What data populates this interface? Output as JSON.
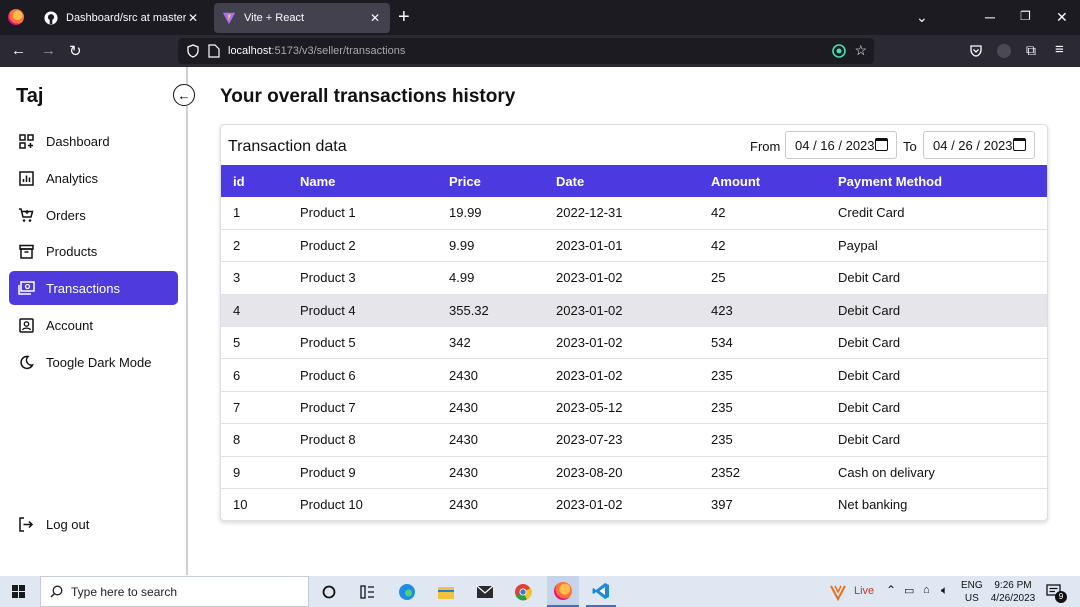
{
  "browser": {
    "tabs": [
      {
        "title": "Dashboard/src at master · Hayat"
      },
      {
        "title": "Vite + React"
      }
    ],
    "url_host": "localhost",
    "url_path": ":5173/v3/seller/transactions"
  },
  "sidebar": {
    "brand": "Taj",
    "items": [
      {
        "label": "Dashboard",
        "icon": "dashboard-icon"
      },
      {
        "label": "Analytics",
        "icon": "analytics-icon"
      },
      {
        "label": "Orders",
        "icon": "cart-icon"
      },
      {
        "label": "Products",
        "icon": "archive-icon"
      },
      {
        "label": "Transactions",
        "icon": "payments-icon",
        "active": true
      },
      {
        "label": "Account",
        "icon": "account-icon"
      },
      {
        "label": "Toogle Dark Mode",
        "icon": "moon-icon"
      }
    ],
    "logout": "Log out"
  },
  "main": {
    "title": "Your overall transactions history",
    "card_title": "Transaction data",
    "from_label": "From",
    "from_value": "04 / 16 / 2023",
    "to_label": "To",
    "to_value": "04 / 26 / 2023"
  },
  "table": {
    "columns": [
      "id",
      "Name",
      "Price",
      "Date",
      "Amount",
      "Payment Method"
    ],
    "rows": [
      [
        "1",
        "Product 1",
        "19.99",
        "2022-12-31",
        "42",
        "Credit Card"
      ],
      [
        "2",
        "Product 2",
        "9.99",
        "2023-01-01",
        "42",
        "Paypal"
      ],
      [
        "3",
        "Product 3",
        "4.99",
        "2023-01-02",
        "25",
        "Debit Card"
      ],
      [
        "4",
        "Product 4",
        "355.32",
        "2023-01-02",
        "423",
        "Debit Card"
      ],
      [
        "5",
        "Product 5",
        "342",
        "2023-01-02",
        "534",
        "Debit Card"
      ],
      [
        "6",
        "Product 6",
        "2430",
        "2023-01-02",
        "235",
        "Debit Card"
      ],
      [
        "7",
        "Product 7",
        "2430",
        "2023-05-12",
        "235",
        "Debit Card"
      ],
      [
        "8",
        "Product 8",
        "2430",
        "2023-07-23",
        "235",
        "Debit Card"
      ],
      [
        "9",
        "Product 9",
        "2430",
        "2023-08-20",
        "2352",
        "Cash on delivary"
      ],
      [
        "10",
        "Product 10",
        "2430",
        "2023-01-02",
        "397",
        "Net banking"
      ]
    ],
    "highlighted_row": 3
  },
  "taskbar": {
    "search_placeholder": "Type here to search",
    "live_label": "Live",
    "lang": "ENG",
    "region": "US",
    "time": "9:26 PM",
    "date": "4/26/2023",
    "notif_count": "9"
  },
  "colors": {
    "accent": "#4f3bdd",
    "header": "#4b3adf"
  }
}
